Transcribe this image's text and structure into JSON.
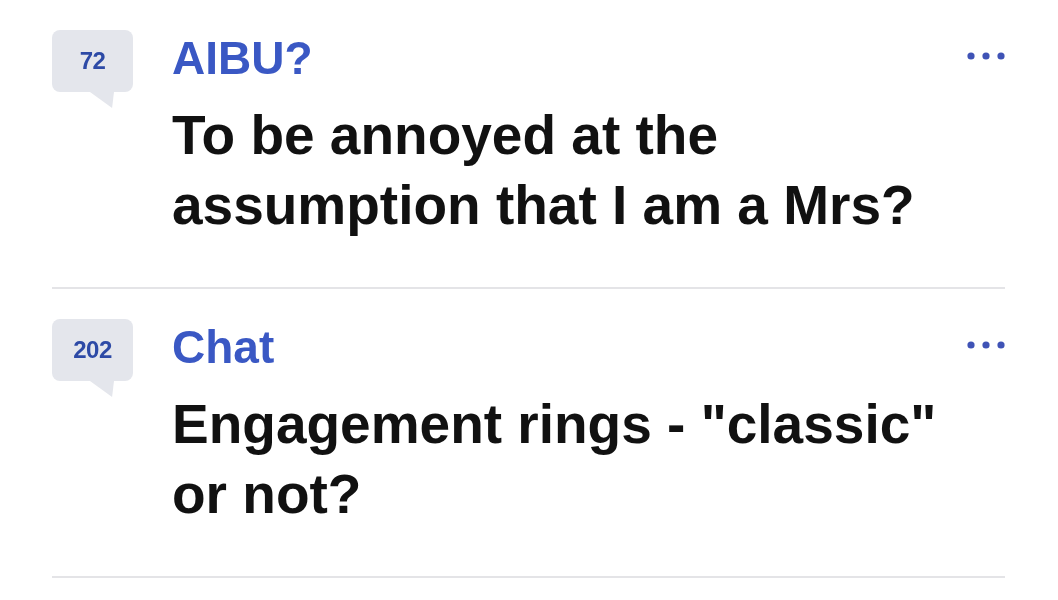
{
  "threads": [
    {
      "reply_count": "72",
      "category": "AIBU?",
      "title": "To be annoyed at the assumption that I am a Mrs?"
    },
    {
      "reply_count": "202",
      "category": "Chat",
      "title": "Engagement rings - \"classic\" or not?"
    }
  ]
}
